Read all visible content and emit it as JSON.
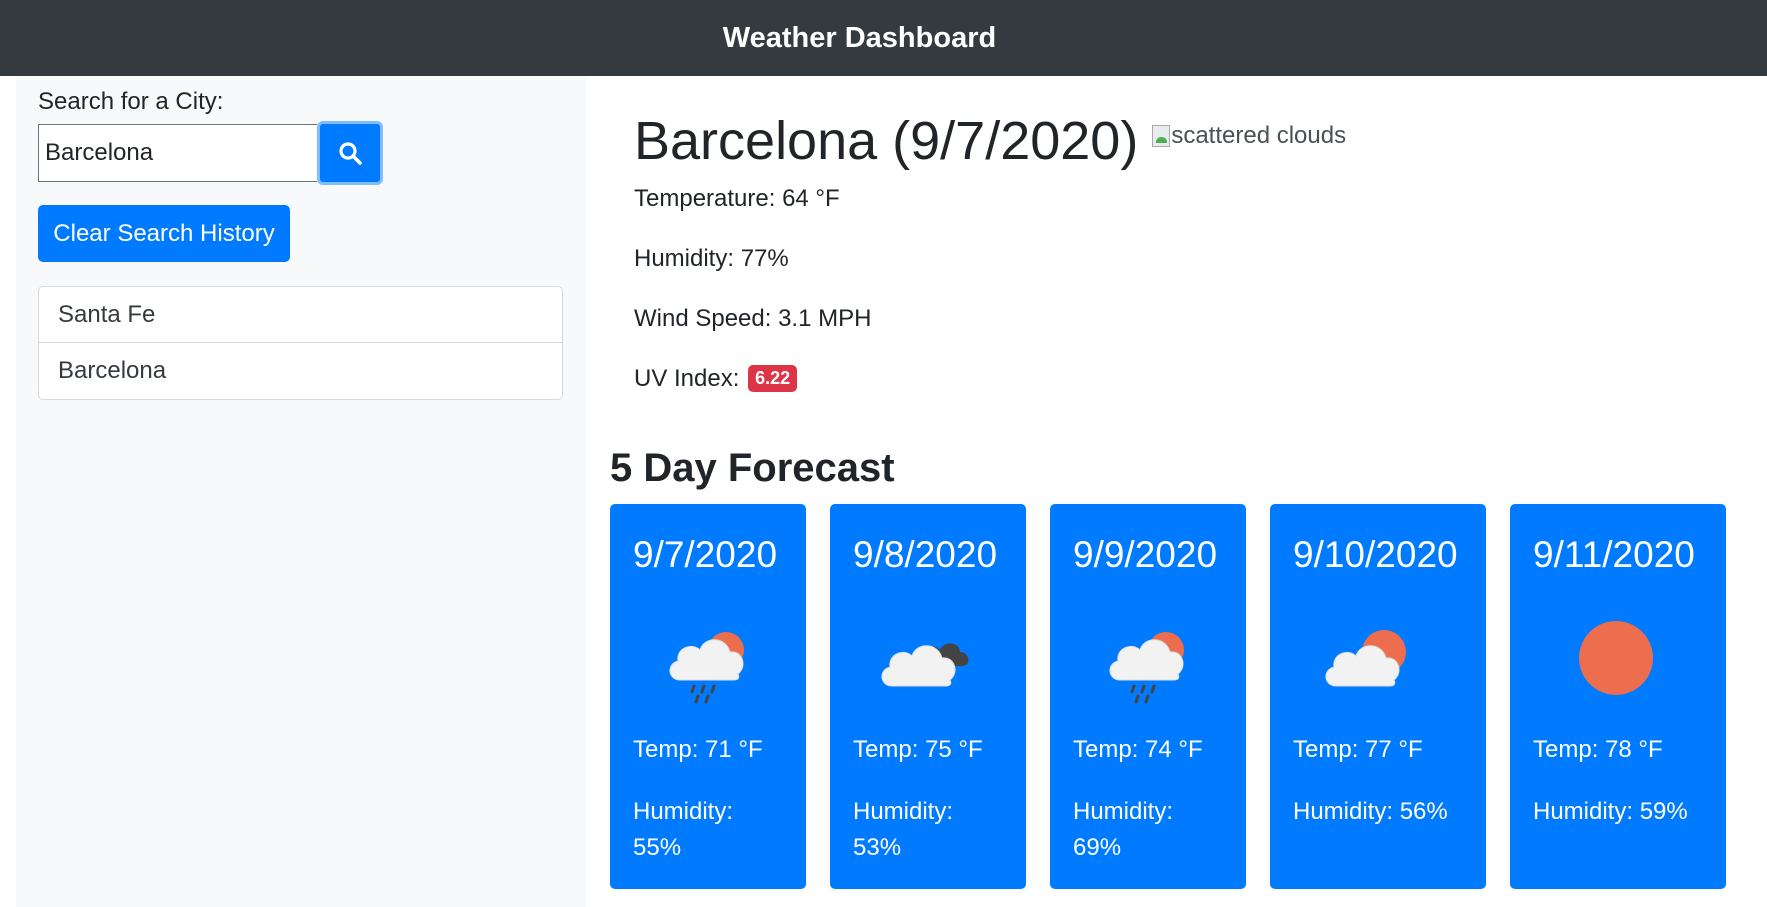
{
  "header": {
    "title": "Weather Dashboard"
  },
  "sidebar": {
    "search_label": "Search for a City:",
    "search_value": "Barcelona",
    "clear_label": "Clear Search History",
    "history": [
      "Santa Fe",
      "Barcelona"
    ]
  },
  "current": {
    "title": "Barcelona (9/7/2020)",
    "icon_alt": "scattered clouds",
    "temperature": "Temperature: 64 °F",
    "humidity": "Humidity: 77%",
    "wind": "Wind Speed: 3.1 MPH",
    "uv_label": "UV Index:",
    "uv_value": "6.22",
    "uv_color": "#dc3545"
  },
  "forecast": {
    "title": "5 Day Forecast",
    "days": [
      {
        "date": "9/7/2020",
        "icon": "rain-cloud-sun-icon",
        "temp": "Temp: 71 °F",
        "humidity": "Humidity: 55%"
      },
      {
        "date": "9/8/2020",
        "icon": "broken-clouds-icon",
        "temp": "Temp: 75 °F",
        "humidity": "Humidity: 53%"
      },
      {
        "date": "9/9/2020",
        "icon": "rain-cloud-sun-icon",
        "temp": "Temp: 74 °F",
        "humidity": "Humidity: 69%"
      },
      {
        "date": "9/10/2020",
        "icon": "partly-cloudy-icon",
        "temp": "Temp: 77 °F",
        "humidity": "Humidity: 56%"
      },
      {
        "date": "9/11/2020",
        "icon": "sun-icon",
        "temp": "Temp: 78 °F",
        "humidity": "Humidity: 59%"
      }
    ]
  },
  "colors": {
    "accent": "#007bff",
    "header_bg": "#343a40",
    "sidebar_bg": "#f8f9fa",
    "sun": "#ed6d4f"
  }
}
